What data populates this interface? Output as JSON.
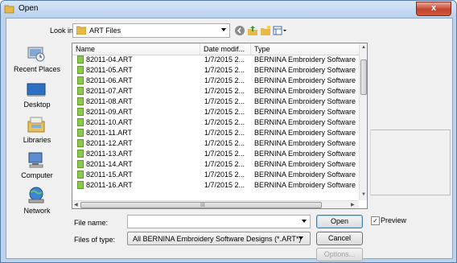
{
  "window": {
    "title": "Open",
    "close_glyph": "x"
  },
  "look_in": {
    "label": "Look in:",
    "value": "ART Files"
  },
  "places": [
    {
      "label": "Recent Places",
      "icon": "recent-places-icon"
    },
    {
      "label": "Desktop",
      "icon": "desktop-icon"
    },
    {
      "label": "Libraries",
      "icon": "libraries-icon"
    },
    {
      "label": "Computer",
      "icon": "computer-icon"
    },
    {
      "label": "Network",
      "icon": "network-icon"
    }
  ],
  "columns": [
    "Name",
    "Date modif...",
    "Type"
  ],
  "files": [
    {
      "name": "82011-04.ART",
      "date": "1/7/2015 2...",
      "type": "BERNINA Embroidery Software Des"
    },
    {
      "name": "82011-05.ART",
      "date": "1/7/2015 2...",
      "type": "BERNINA Embroidery Software Des"
    },
    {
      "name": "82011-06.ART",
      "date": "1/7/2015 2...",
      "type": "BERNINA Embroidery Software Des"
    },
    {
      "name": "82011-07.ART",
      "date": "1/7/2015 2...",
      "type": "BERNINA Embroidery Software Des"
    },
    {
      "name": "82011-08.ART",
      "date": "1/7/2015 2...",
      "type": "BERNINA Embroidery Software Des"
    },
    {
      "name": "82011-09.ART",
      "date": "1/7/2015 2...",
      "type": "BERNINA Embroidery Software Des"
    },
    {
      "name": "82011-10.ART",
      "date": "1/7/2015 2...",
      "type": "BERNINA Embroidery Software Des"
    },
    {
      "name": "82011-11.ART",
      "date": "1/7/2015 2...",
      "type": "BERNINA Embroidery Software Des"
    },
    {
      "name": "82011-12.ART",
      "date": "1/7/2015 2...",
      "type": "BERNINA Embroidery Software Des"
    },
    {
      "name": "82011-13.ART",
      "date": "1/7/2015 2...",
      "type": "BERNINA Embroidery Software Des"
    },
    {
      "name": "82011-14.ART",
      "date": "1/7/2015 2...",
      "type": "BERNINA Embroidery Software Des"
    },
    {
      "name": "82011-15.ART",
      "date": "1/7/2015 2...",
      "type": "BERNINA Embroidery Software Des"
    },
    {
      "name": "82011-16.ART",
      "date": "1/7/2015 2...",
      "type": "BERNINA Embroidery Software Des"
    }
  ],
  "scroll_grip": "III",
  "file_name": {
    "label": "File name:",
    "value": ""
  },
  "file_type": {
    "label": "Files of type:",
    "value": "All BERNINA Embroidery Software Designs (*.ART*)"
  },
  "buttons": {
    "open": "Open",
    "cancel": "Cancel",
    "options": "Options..."
  },
  "preview": {
    "label": "Preview",
    "checked": true,
    "check_glyph": "✓"
  },
  "colors": {
    "title_gradient_top": "#d6e6f8",
    "close_red": "#c4422c",
    "folder": "#e8b949",
    "file_icon": "#8cc84b"
  }
}
